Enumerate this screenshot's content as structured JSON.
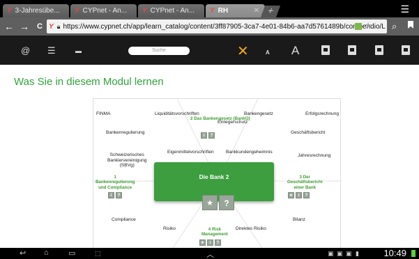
{
  "browser": {
    "tabs": [
      {
        "label": "3-Jahresübe...",
        "active": false
      },
      {
        "label": "CYPnet - An...",
        "active": false
      },
      {
        "label": "CYPnet - An...",
        "active": false
      },
      {
        "label": "RH",
        "active": true
      }
    ],
    "new_tab_symbol": "+",
    "url": "https://www.cypnet.ch/app/learn_catalog/content/3ff87905-3ca7-4e01-84b6-aa7d5761489b/compendio/L",
    "back_symbol": "←",
    "forward_symbol": "→",
    "reload_symbol": "C"
  },
  "toolbar": {
    "search_placeholder": "Suche"
  },
  "page": {
    "title": "Was Sie in diesem Modul lernen"
  },
  "diagram": {
    "labels": {
      "finma": "FINMA",
      "liquiditaet": "Liquiditätsvorschriften",
      "bankengesetz": "Bankengesetz",
      "erfolgsrechnung": "Erfolgsrechnung",
      "bankenregulierung": "Bankenregulierung",
      "einlegerschutz": "Einlegerschutz",
      "geschaeftsbericht": "Geschäftsbericht",
      "sbvg": "Schweizerisches\nBankiervereinigung\n(SBVg)",
      "eigenmittel": "Eigenmittelvorschriften",
      "bankkunden": "Bankkundengeheimnis",
      "jahresrechnung": "Jahresrechnung",
      "compliance": "Compliance",
      "risiko": "Risiko",
      "direktes_risiko": "Direktes Risiko",
      "bilanz": "Bilanz"
    },
    "modules": {
      "m1": "1\nBankenregulierung\nund Compliance",
      "m2": "2 Das\nBankengesetz\n(BankG)",
      "m3": "3 Der\nGeschäftsbericht\neiner Bank",
      "m4": "4 Risk\nManagement"
    },
    "center_title": "Die Bank 2",
    "star_symbol": "★",
    "help_symbol": "?",
    "small_button_symbols": [
      "i",
      "?"
    ]
  },
  "system": {
    "clock": "10:49"
  },
  "colors": {
    "accent_green": "#3c9e3e",
    "title_green": "#2fa33b",
    "close_orange": "#f5a623",
    "toolbar_bg": "#1a1a1a"
  }
}
